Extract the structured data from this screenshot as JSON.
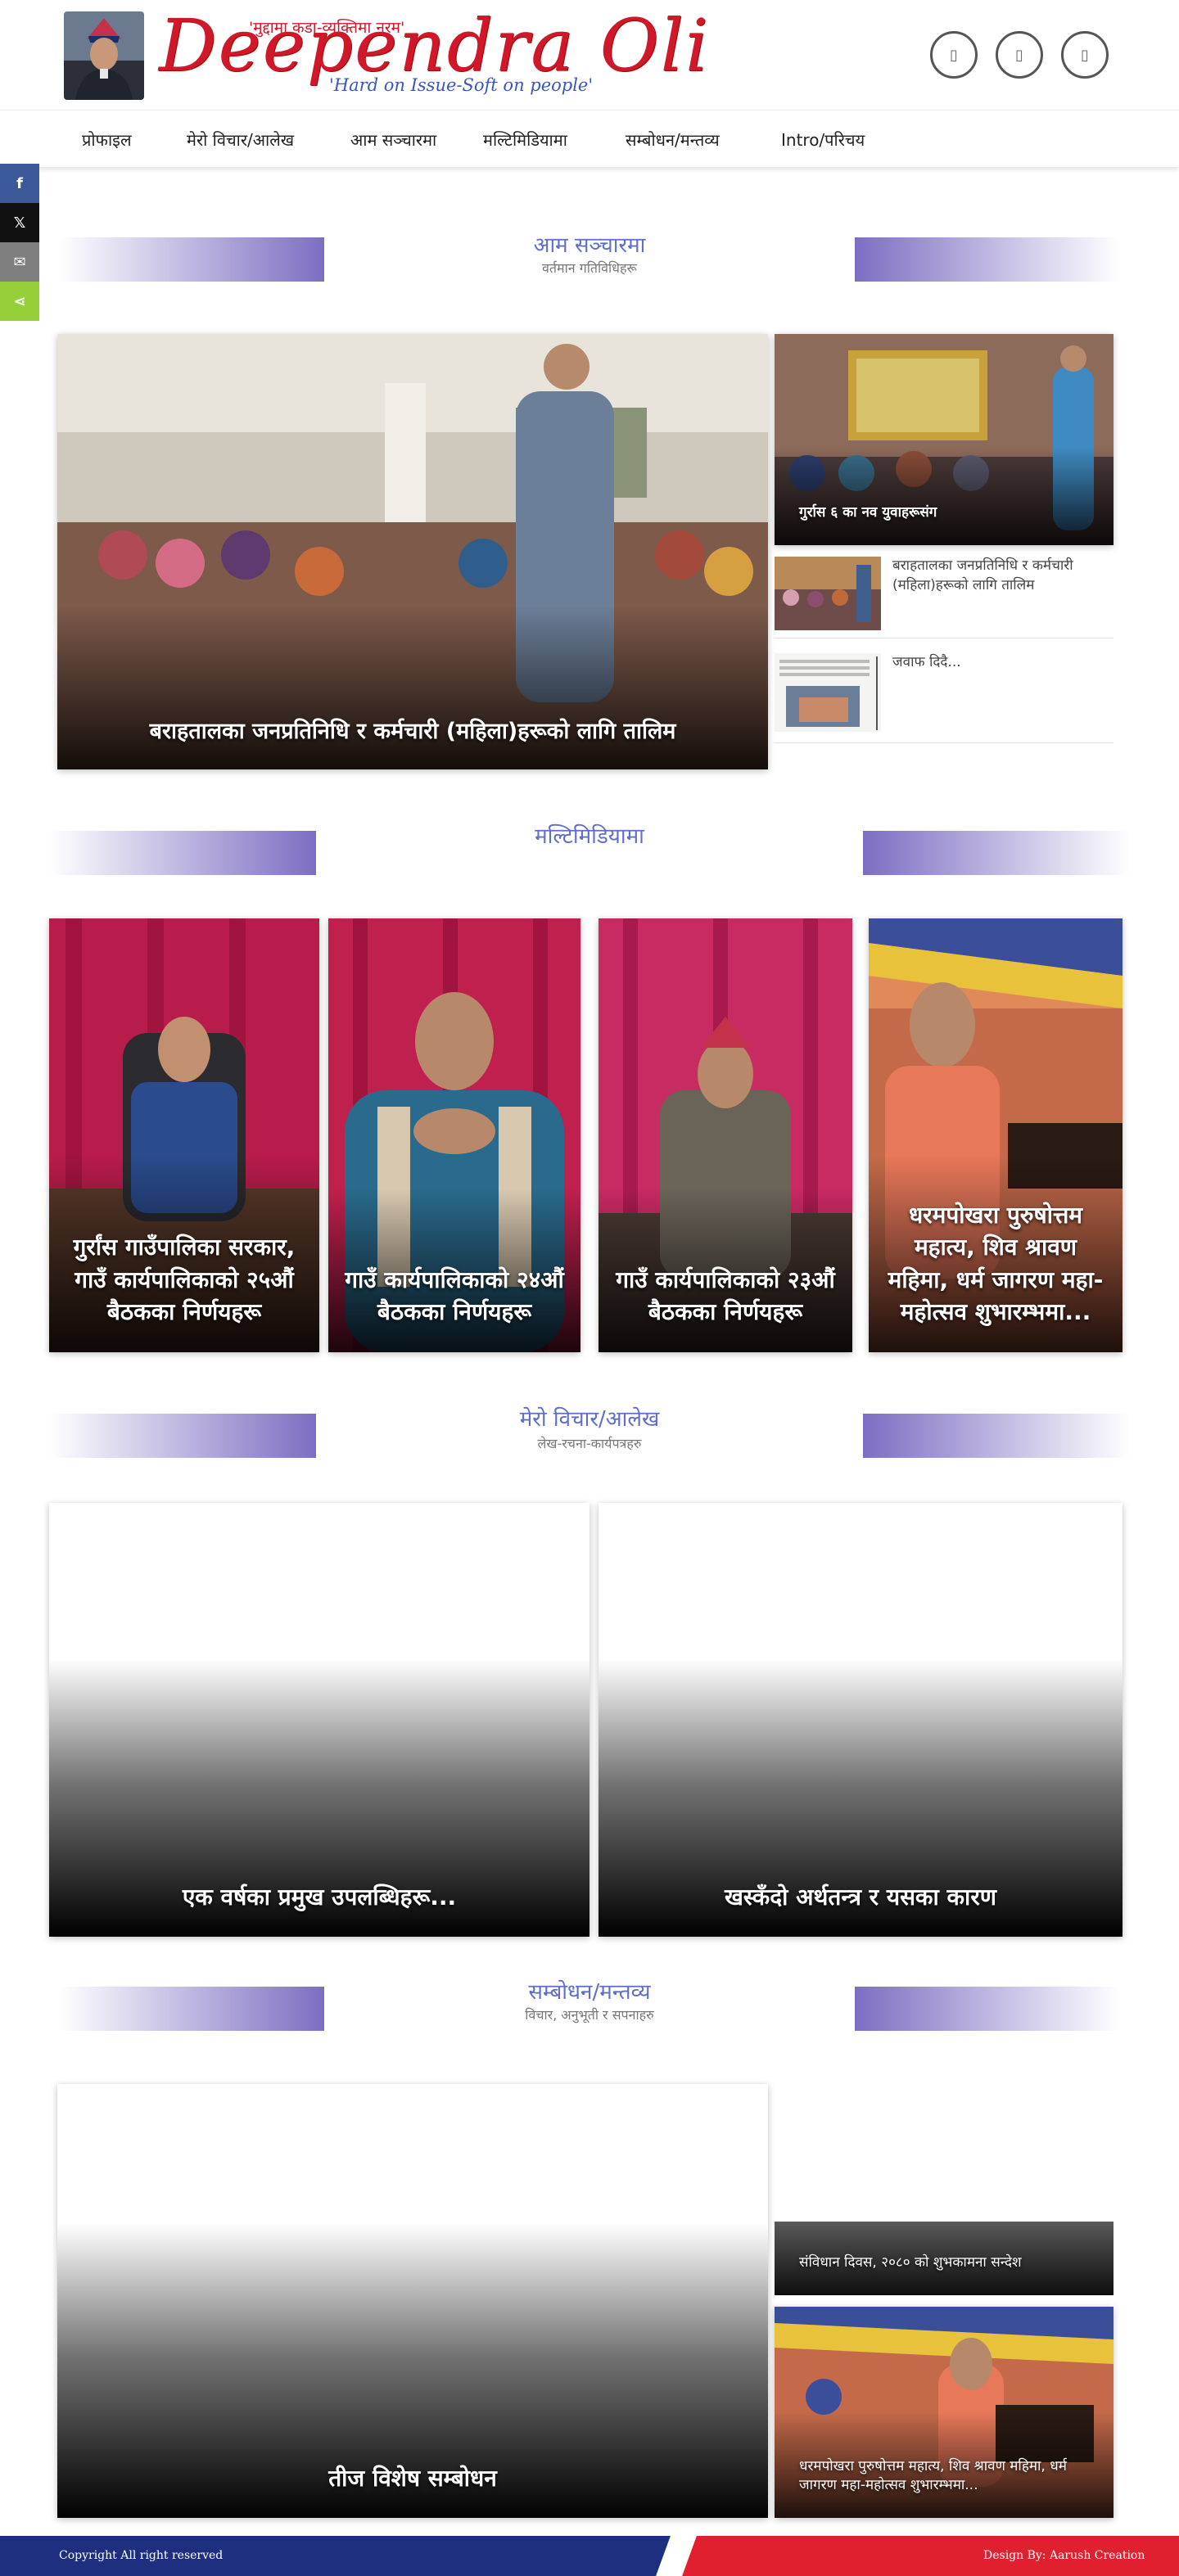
{
  "header": {
    "tagline_top": "'मुद्दामा कडा-व्यक्तिमा नरम'",
    "brand": "Deependra Oli",
    "tagline_bottom": "'Hard on Issue-Soft on people'",
    "social_icons": [
      "social-icon-1",
      "social-icon-2",
      "social-icon-3"
    ]
  },
  "nav": {
    "items": [
      "प्रोफाइल",
      "मेरो विचार/आलेख",
      "आम सञ्चारमा",
      "मल्टिमिडियामा",
      "सम्बोधन/मन्तव्य",
      "Intro/परिचय"
    ]
  },
  "share_bar": {
    "items": [
      {
        "icon": "facebook-icon",
        "glyph": "f",
        "color": "#3b5998"
      },
      {
        "icon": "x-icon",
        "glyph": "𝕏",
        "color": "#111111"
      },
      {
        "icon": "email-icon",
        "glyph": "✉",
        "color": "#7f7f7f"
      },
      {
        "icon": "share-icon",
        "glyph": "⋖",
        "color": "#95d03a"
      }
    ]
  },
  "sections": {
    "mass_media": {
      "title": "आम सञ्चारमा",
      "subtitle": "वर्तमान गतिविधिहरू",
      "main_caption": "बराहतालका जनप्रतिनिधि र कर्मचारी (महिला)हरूको लागि तालिम",
      "side_caption": "गुर्रास ६ का नव युवाहरूसंग",
      "side_items": [
        "बराहतालका जनप्रतिनिधि र कर्मचारी (महिला)हरूको लागि तालिम",
        "जवाफ दिदै..."
      ]
    },
    "multimedia": {
      "title": "मल्टिमिडियामा",
      "cards": [
        "गुर्रांस गाउँपालिका सरकार, गाउँ कार्यपालिकाको २५औं बैठकका निर्णयहरू",
        "गाउँ कार्यपालिकाको २४औं बैठकका निर्णयहरू",
        "गाउँ कार्यपालिकाको २३औं बैठकका निर्णयहरू",
        "धरमपोखरा पुरुषोत्तम महात्य, शिव श्रावण महिमा, धर्म जागरण महा-महोत्सव शुभारम्भमा..."
      ]
    },
    "opinion": {
      "title": "मेरो विचार/आलेख",
      "subtitle": "लेख-रचना-कार्यपत्रहरु",
      "cards": [
        "एक वर्षका प्रमुख उपलब्धिहरू...",
        "खस्कँदो अर्थतन्त्र र यसका कारण"
      ]
    },
    "speeches": {
      "title": "सम्बोधन/मन्तव्य",
      "subtitle": "विचार, अनुभूती र सपनाहरु",
      "main_caption": "तीज विशेष सम्बोधन",
      "side_cards": [
        "संविधान दिवस, २०८० को शुभकामना सन्देश",
        "धरमपोखरा पुरुषोत्तम महात्य, शिव श्रावण महिमा, धर्म जागरण महा-महोत्सव शुभारम्भमा..."
      ]
    }
  },
  "footer": {
    "copyright": "Copyright All right reserved",
    "credit": "Design By: Aarush Creation"
  },
  "colors": {
    "brand_red": "#d0182b",
    "accent_purple": "#7d6ec2",
    "heading_blue": "#5f6fc7",
    "footer_navy": "#1f2f7f",
    "footer_red": "#e0202e"
  }
}
